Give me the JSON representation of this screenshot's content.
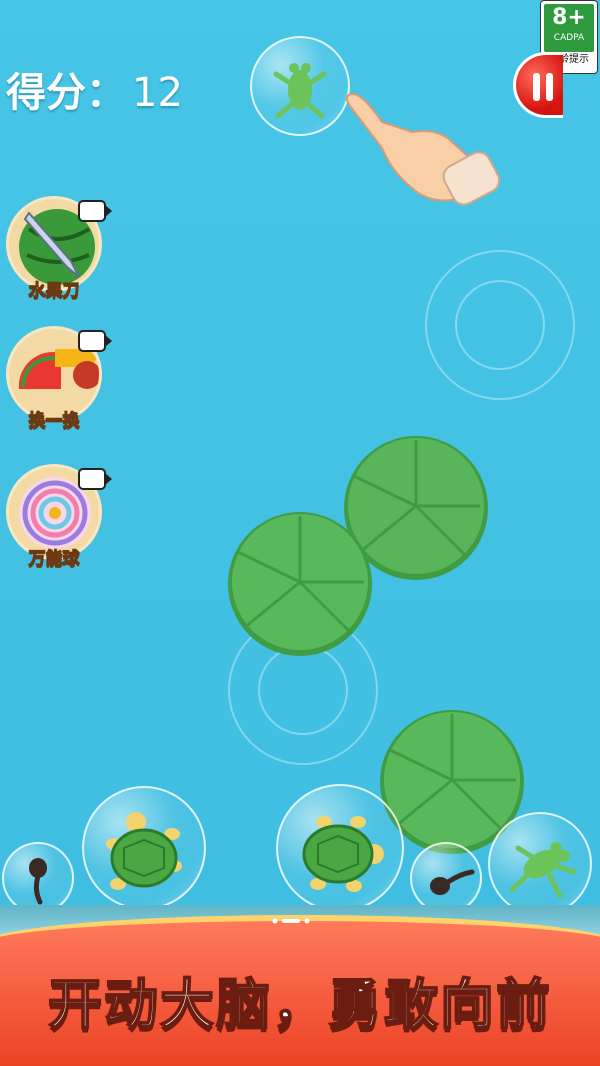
{
  "score": {
    "label": "得分：",
    "value": "12"
  },
  "age_rating": {
    "rating": "8+",
    "org": "CADPA",
    "hint": "适龄提示"
  },
  "powerups": [
    {
      "label": "水果刀",
      "icon": "watermelon-knife-icon"
    },
    {
      "label": "换一换",
      "icon": "swap-fruit-icon"
    },
    {
      "label": "万能球",
      "icon": "rainbow-ball-icon"
    }
  ],
  "pause": {
    "icon": "pause-icon"
  },
  "banner": {
    "text": "开动大脑，勇敢向前"
  },
  "colors": {
    "water": "#45c2e3",
    "banner": "#f05a3a",
    "lily": "#4caf50",
    "pause": "#e0231a"
  },
  "bubbles": [
    {
      "creature": "frog",
      "icon": "frog-icon"
    },
    {
      "creature": "tadpole",
      "icon": "tadpole-icon"
    },
    {
      "creature": "turtle",
      "icon": "turtle-icon"
    },
    {
      "creature": "turtle",
      "icon": "turtle-icon"
    },
    {
      "creature": "tadpole",
      "icon": "tadpole-icon"
    },
    {
      "creature": "frog",
      "icon": "frog-icon"
    }
  ]
}
